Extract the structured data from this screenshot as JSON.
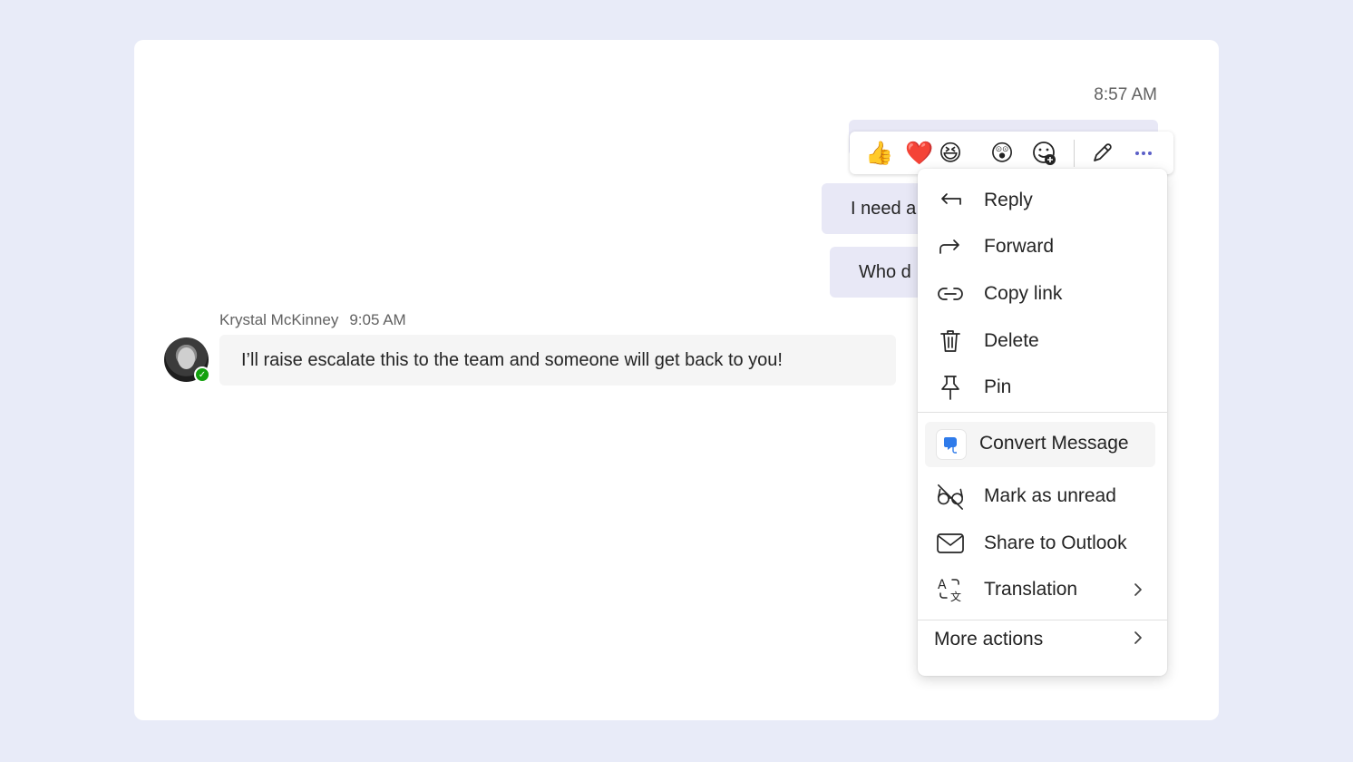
{
  "chat": {
    "own_timestamp": "8:57 AM",
    "own_messages": [
      {
        "text": ""
      },
      {
        "text": "I need a"
      },
      {
        "text": "Who d"
      }
    ],
    "incoming": {
      "sender": "Krystal McKinney",
      "time": "9:05 AM",
      "text": "I’ll raise escalate this to the team and someone will get back to you!"
    }
  },
  "reactions": {
    "items": [
      {
        "name": "like",
        "glyph": "👍"
      },
      {
        "name": "heart",
        "glyph": "❤️"
      },
      {
        "name": "laugh",
        "glyph": "😆"
      },
      {
        "name": "surprised",
        "glyph": "😲"
      }
    ],
    "add_reaction_icon": "emoji-add-icon",
    "edit_icon": "pencil-icon",
    "more_icon": "more-dots-icon",
    "accent_color": "#5b5fc7"
  },
  "menu": {
    "items": [
      {
        "label": "Reply",
        "icon": "reply-icon"
      },
      {
        "label": "Forward",
        "icon": "forward-icon"
      },
      {
        "label": "Copy link",
        "icon": "link-icon"
      },
      {
        "label": "Delete",
        "icon": "trash-icon"
      },
      {
        "label": "Pin",
        "icon": "pin-icon"
      }
    ],
    "convert": {
      "label": "Convert Message",
      "icon": "convert-app-icon",
      "color": "#2f7bea"
    },
    "items2": [
      {
        "label": "Mark as unread",
        "icon": "glasses-off-icon"
      },
      {
        "label": "Share to Outlook",
        "icon": "mail-icon"
      },
      {
        "label": "Translation",
        "icon": "translate-icon"
      }
    ],
    "more_actions": {
      "label": "More actions"
    }
  }
}
